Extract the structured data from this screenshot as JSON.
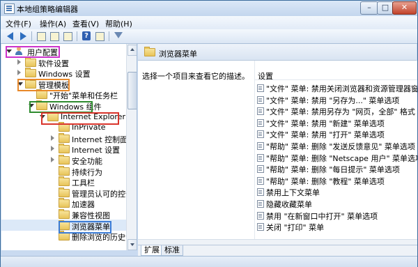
{
  "window": {
    "title": "本地组策略编辑器"
  },
  "menu": [
    "文件(F)",
    "操作(A)",
    "查看(V)",
    "帮助(H)"
  ],
  "tree": [
    {
      "label": "用户配置",
      "icon": "user-icon",
      "expander": "open",
      "selected": false
    },
    {
      "label": "软件设置",
      "icon": "folder-icon",
      "expander": "closed",
      "selected": false
    },
    {
      "label": "Windows 设置",
      "icon": "folder-icon",
      "expander": "closed",
      "selected": false
    },
    {
      "label": "管理模板",
      "icon": "folder-icon",
      "expander": "open",
      "selected": false
    },
    {
      "label": "\"开始\"菜单和任务栏",
      "icon": "folder-icon",
      "expander": "none",
      "selected": false
    },
    {
      "label": "Windows 组件",
      "icon": "folder-icon",
      "expander": "open",
      "selected": false
    },
    {
      "label": "Internet Explorer",
      "icon": "folder-icon",
      "expander": "open",
      "selected": false
    },
    {
      "label": "InPrivate",
      "icon": "folder-icon",
      "expander": "none",
      "selected": false
    },
    {
      "label": "Internet 控制面板",
      "icon": "folder-icon",
      "expander": "closed",
      "selected": false
    },
    {
      "label": "Internet 设置",
      "icon": "folder-icon",
      "expander": "closed",
      "selected": false
    },
    {
      "label": "安全功能",
      "icon": "folder-icon",
      "expander": "closed",
      "selected": false
    },
    {
      "label": "持续行为",
      "icon": "folder-icon",
      "expander": "none",
      "selected": false
    },
    {
      "label": "工具栏",
      "icon": "folder-icon",
      "expander": "none",
      "selected": false
    },
    {
      "label": "管理员认可的控件",
      "icon": "folder-icon",
      "expander": "none",
      "selected": false
    },
    {
      "label": "加速器",
      "icon": "folder-icon",
      "expander": "none",
      "selected": false
    },
    {
      "label": "兼容性视图",
      "icon": "folder-icon",
      "expander": "none",
      "selected": false
    },
    {
      "label": "浏览器菜单",
      "icon": "folder-icon",
      "expander": "none",
      "selected": true
    },
    {
      "label": "删除浏览的历史记录",
      "icon": "folder-icon",
      "expander": "none",
      "selected": false
    }
  ],
  "highlight_colors": {
    "user_config": "#cc33cc",
    "admin_templates": "#e8892a",
    "windows_components": "#2e8b2e",
    "internet_explorer": "#d9342b",
    "browser_menu": "#3a7bd5"
  },
  "right": {
    "header": "浏览器菜单",
    "description": "选择一个项目来查看它的描述。",
    "settings_header": "设置",
    "settings": [
      "\"文件\" 菜单: 禁用关闭浏览器和资源管理器窗口",
      "\"文件\" 菜单: 禁用 \"另存为...\" 菜单选项",
      "\"文件\" 菜单: 禁用另存为 \"网页，全部\" 格式",
      "\"文件\" 菜单: 禁用 \"新建\" 菜单选项",
      "\"文件\" 菜单: 禁用 \"打开\" 菜单选项",
      "\"帮助\" 菜单: 删除 \"发送反馈意见\" 菜单选项",
      "\"帮助\" 菜单: 删除 \"Netscape 用户\" 菜单选项",
      "\"帮助\" 菜单: 删除 \"每日提示\" 菜单选项",
      "\"帮助\" 菜单: 删除 \"教程\" 菜单选项",
      "禁用上下文菜单",
      "隐藏收藏菜单",
      "禁用 \"在新窗口中打开\" 菜单选项",
      "关闭 \"打印\" 菜单"
    ]
  },
  "tabs": [
    "扩展",
    "标准"
  ]
}
